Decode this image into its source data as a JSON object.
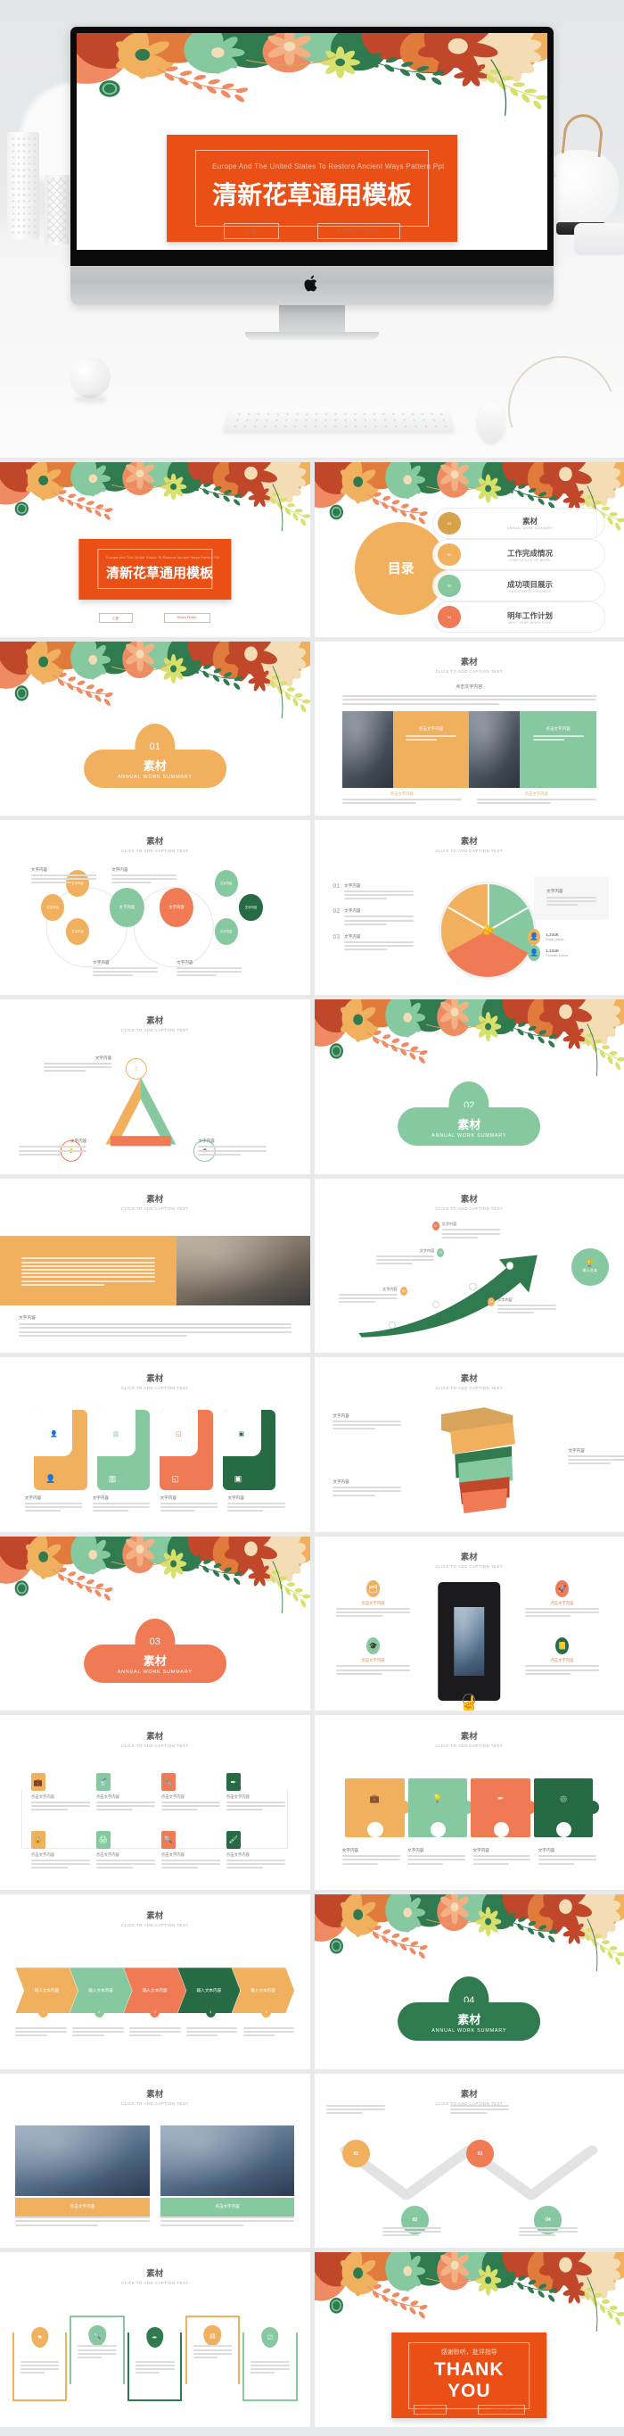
{
  "palette": {
    "orange": "#ea4f16",
    "amber": "#f0b05e",
    "mint": "#86c9a0",
    "coral": "#ef7a54",
    "forest": "#2f7a4f",
    "darkgreen": "#276b44",
    "tan": "#d7a45c",
    "rust": "#c0472a",
    "lime": "#d6e06a",
    "page_bg": "#e8e9eb"
  },
  "hero": {
    "device": "imac-mockup",
    "apple_logo": "apple-icon",
    "slide": {
      "subtitle": "Europe And The United States To Restore Ancient Ways Pattern Ppt",
      "title": "清新花草通用模板",
      "field_left": "汇报:",
      "field_right": "Report Person:"
    }
  },
  "common": {
    "caption_en": "CLICK TO ADD CAPTION TEXT",
    "caption_zh": "素材",
    "text_zh": "文字内容",
    "click_text_zh": "点击文字内容",
    "input_text_zh": "输入文本内容",
    "input_text_zh2": "输入文本",
    "lorem_en": "Please replace text, click add relevant headline, modify the text content, also can copy your content to this directly.",
    "lorem_zh": "文字内容、简洁明了简单扼要阐述您的文字内容、简洁明了简单扼要阐述您的文字内容"
  },
  "slides": [
    {
      "n": 1,
      "type": "title",
      "subtitle": "Europe And The United States To Restore Ancient Ways Pattern Ppt",
      "title": "清新花草通用模板",
      "field_left": "汇报:",
      "field_right": "Report Person:"
    },
    {
      "n": 2,
      "type": "toc",
      "circle_label": "目录",
      "items": [
        {
          "num": "01",
          "zh": "素材",
          "en": "ANNUAL WORK SUMMARY",
          "color": "#d9a24a"
        },
        {
          "num": "02",
          "zh": "工作完成情况",
          "en": "COMPLETION OF WORK",
          "color": "#f0b05e"
        },
        {
          "num": "03",
          "zh": "成功项目展示",
          "en": "SUCCESSFUL PROJECT",
          "color": "#86c9a0"
        },
        {
          "num": "04",
          "zh": "明年工作计划",
          "en": "NEXT YEAR WORK PLAN",
          "color": "#ef7a54"
        }
      ]
    },
    {
      "n": 3,
      "type": "section",
      "num": "01",
      "zh": "素材",
      "en": "ANNUAL WORK SUMMARY",
      "color": "#f0b05e"
    },
    {
      "n": 4,
      "type": "two-photo",
      "title_zh": "素材",
      "title_en": "CLICK TO ADD CAPTION TEXT",
      "lead_zh": "点击文字内容",
      "cards": [
        {
          "zh": "点击文字内容",
          "color": "#f0b05e",
          "bar": "#86c9a0"
        },
        {
          "zh": "点击文字内容",
          "color": "#86c9a0",
          "bar": "#ef7a54"
        }
      ],
      "captions": [
        "点击文字内容",
        "点击文字内容"
      ]
    },
    {
      "n": 5,
      "type": "circles",
      "title_zh": "素材",
      "title_en": "CLICK TO ADD CAPTION TEXT",
      "nodes": [
        {
          "zh": "文字内容",
          "color": "#f0b05e"
        },
        {
          "zh": "文字内容",
          "color": "#f0b05e"
        },
        {
          "zh": "文字内容",
          "color": "#f0b05e"
        },
        {
          "zh": "文字内容",
          "color": "#86c9a0"
        },
        {
          "zh": "文字内容",
          "color": "#ef7a54"
        },
        {
          "zh": "文字内容",
          "color": "#86c9a0"
        },
        {
          "zh": "文字内容",
          "color": "#86c9a0"
        },
        {
          "zh": "文字内容",
          "color": "#276b44"
        }
      ],
      "labels": [
        "文字内容",
        "文字内容",
        "文字内容",
        "文字内容"
      ]
    },
    {
      "n": 6,
      "type": "pie",
      "title_zh": "素材",
      "title_en": "CLICK TO ADD CAPTION TEXT",
      "list": [
        {
          "num": "01",
          "zh": "文字内容"
        },
        {
          "num": "02",
          "zh": "文字内容"
        },
        {
          "num": "03",
          "zh": "文字内容"
        }
      ],
      "note_zh": "文字内容",
      "stats": [
        {
          "value": "1,234K",
          "label": "Male Users",
          "color": "#f0b05e",
          "icon": "male-icon"
        },
        {
          "value": "1,234K",
          "label": "Female Users",
          "color": "#86c9a0",
          "icon": "female-icon"
        }
      ],
      "slices": [
        {
          "color": "#f0b05e",
          "icon": "handshake-icon"
        },
        {
          "color": "#86c9a0",
          "icon": "key-icon"
        },
        {
          "color": "#ef7a54",
          "icon": "deal-icon"
        }
      ]
    },
    {
      "n": 7,
      "type": "triangle",
      "title_zh": "素材",
      "title_en": "CLICK TO ADD CAPTION TEXT",
      "sides": [
        {
          "zh": "文字内容",
          "color": "#f0b05e",
          "icon": "mobile-icon"
        },
        {
          "zh": "文字内容",
          "color": "#86c9a0",
          "icon": "megaphone-icon"
        },
        {
          "zh": "文字内容",
          "color": "#ef7a54",
          "icon": "bulb-icon"
        }
      ]
    },
    {
      "n": 8,
      "type": "section",
      "num": "02",
      "zh": "素材",
      "en": "ANNUAL WORK SUMMARY",
      "color": "#86c9a0"
    },
    {
      "n": 9,
      "type": "photo-text",
      "title_zh": "素材",
      "title_en": "CLICK TO ADD CAPTION TEXT",
      "panel_color": "#f0b05e",
      "foot_zh": "文字内容"
    },
    {
      "n": 10,
      "type": "arrow",
      "title_zh": "素材",
      "title_en": "CLICK TO ADD CAPTION TEXT",
      "tip_zh": "输入文本",
      "steps": [
        {
          "num": "01",
          "zh": "文字内容",
          "color": "#f0b05e"
        },
        {
          "num": "02",
          "zh": "文字内容",
          "color": "#86c9a0"
        },
        {
          "num": "03",
          "zh": "文字内容",
          "color": "#ef7a54"
        },
        {
          "num": "04",
          "zh": "文字内容",
          "color": "#f0b05e"
        }
      ]
    },
    {
      "n": 11,
      "type": "cards4",
      "title_zh": "素材",
      "title_en": "CLICK TO ADD CAPTION TEXT",
      "cards": [
        {
          "zh": "文字内容",
          "color": "#f0b05e",
          "icon": "person-icon"
        },
        {
          "zh": "文字内容",
          "color": "#86c9a0",
          "icon": "chart-icon"
        },
        {
          "zh": "文字内容",
          "color": "#ef7a54",
          "icon": "layers-icon"
        },
        {
          "zh": "文字内容",
          "color": "#276b44",
          "icon": "monitor-icon"
        }
      ]
    },
    {
      "n": 12,
      "type": "ribbon",
      "title_zh": "素材",
      "title_en": "CLICK TO ADD CAPTION TEXT",
      "labels": [
        "文字内容",
        "文字内容",
        "文字内容"
      ],
      "bands": [
        {
          "color": "#d7a45c",
          "icon": "bars-icon"
        },
        {
          "color": "#2f7a4f",
          "icon": "leaf-icon"
        },
        {
          "color": "#c0472a",
          "icon": "flag-icon"
        }
      ]
    },
    {
      "n": 13,
      "type": "section",
      "num": "03",
      "zh": "素材",
      "en": "ANNUAL WORK SUMMARY",
      "color": "#ef7a54"
    },
    {
      "n": 14,
      "type": "tablet",
      "title_zh": "素材",
      "title_en": "CLICK TO ADD CAPTION TEXT",
      "items": [
        {
          "zh": "点击文字内容",
          "color": "#f0b05e",
          "icon": "folder-icon"
        },
        {
          "zh": "点击文字内容",
          "color": "#ef7a54",
          "icon": "rocket-icon"
        },
        {
          "zh": "点击文字内容",
          "color": "#86c9a0",
          "icon": "cap-icon"
        },
        {
          "zh": "点击文字内容",
          "color": "#276b44",
          "icon": "book-icon"
        }
      ]
    },
    {
      "n": 15,
      "type": "timeline8",
      "title_zh": "素材",
      "title_en": "CLICK TO ADD CAPTION TEXT",
      "nodes": [
        {
          "zh": "点击文字内容",
          "color": "#f0b05e",
          "icon": "bag-icon"
        },
        {
          "zh": "点击文字内容",
          "color": "#86c9a0",
          "icon": "cup-icon"
        },
        {
          "zh": "点击文字内容",
          "color": "#ef7a54",
          "icon": "wrench-icon"
        },
        {
          "zh": "点击文字内容",
          "color": "#276b44",
          "icon": "pen-icon"
        },
        {
          "zh": "点击文字内容",
          "color": "#f0b05e",
          "icon": "lock-icon"
        },
        {
          "zh": "点击文字内容",
          "color": "#86c9a0",
          "icon": "printer-icon"
        },
        {
          "zh": "点击文字内容",
          "color": "#ef7a54",
          "icon": "search-icon"
        },
        {
          "zh": "点击文字内容",
          "color": "#276b44",
          "icon": "brush-icon"
        }
      ]
    },
    {
      "n": 16,
      "type": "puzzle",
      "title_zh": "素材",
      "title_en": "CLICK TO ADD CAPTION TEXT",
      "pieces": [
        {
          "zh": "文字内容",
          "color": "#f0b05e",
          "icon": "case-icon"
        },
        {
          "zh": "文字内容",
          "color": "#86c9a0",
          "icon": "bulb-icon"
        },
        {
          "zh": "文字内容",
          "color": "#ef7a54",
          "icon": "pen-icon"
        },
        {
          "zh": "文字内容",
          "color": "#276b44",
          "icon": "eye-icon"
        }
      ]
    },
    {
      "n": 17,
      "type": "chevrons",
      "title_zh": "素材",
      "title_en": "CLICK TO ADD CAPTION TEXT",
      "steps": [
        {
          "label": "输入文本内容",
          "num": "1",
          "color": "#f0b05e"
        },
        {
          "label": "输入文本内容",
          "num": "2",
          "color": "#86c9a0"
        },
        {
          "label": "输入文本内容",
          "num": "3",
          "color": "#ef7a54"
        },
        {
          "label": "输入文本内容",
          "num": "4",
          "color": "#276b44"
        },
        {
          "label": "输入文本内容",
          "num": "5",
          "color": "#f0b05e"
        }
      ]
    },
    {
      "n": 18,
      "type": "section",
      "num": "04",
      "zh": "素材",
      "en": "ANNUAL WORK SUMMARY",
      "color": "#2f7a4f"
    },
    {
      "n": 19,
      "type": "two-building",
      "title_zh": "素材",
      "title_en": "CLICK TO ADD CAPTION TEXT",
      "bars": [
        {
          "zh": "点击文字内容",
          "color": "#f0b05e"
        },
        {
          "zh": "点击文字内容",
          "color": "#86c9a0"
        }
      ]
    },
    {
      "n": 20,
      "type": "zigzag",
      "title_zh": "素材",
      "title_en": "CLICK TO ADD CAPTION TEXT",
      "nodes": [
        {
          "num": "01",
          "color": "#f0b05e"
        },
        {
          "num": "02",
          "color": "#86c9a0"
        },
        {
          "num": "03",
          "color": "#ef7a54"
        },
        {
          "num": "04",
          "color": "#86c9a0"
        }
      ]
    },
    {
      "n": 21,
      "type": "steps5",
      "title_zh": "素材",
      "title_en": "CLICK TO ADD CAPTION TEXT",
      "boxes": [
        {
          "color": "#f0b05e",
          "icon": "flag-icon"
        },
        {
          "color": "#86c9a0",
          "icon": "search-icon"
        },
        {
          "color": "#2f7a4f",
          "icon": "pen-icon"
        },
        {
          "color": "#f0b05e",
          "icon": "doc-icon"
        },
        {
          "color": "#86c9a0",
          "icon": "check-icon"
        }
      ]
    },
    {
      "n": 22,
      "type": "thanks",
      "zh": "感谢聆听，批评指导",
      "en": "THANK YOU",
      "field_left": "汇报:",
      "field_right": "Report Person:"
    }
  ]
}
